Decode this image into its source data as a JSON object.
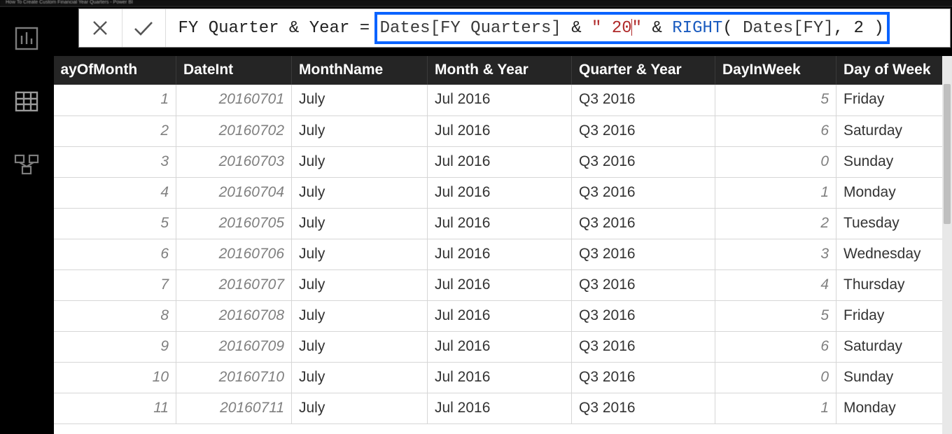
{
  "window_title": "How To Create Custom Financial Year Quarters - Power BI",
  "formula": {
    "measure_name": "FY Quarter & Year",
    "equals": " = ",
    "col1": "Dates[FY Quarters]",
    "amp1": " & ",
    "str_open": "\" 2",
    "str_typing": "0",
    "str_close": "\"",
    "amp2": " & ",
    "fn": "RIGHT",
    "open": "( ",
    "col2": "Dates[FY]",
    "comma": ", ",
    "num": "2",
    "close": " )"
  },
  "columns": [
    {
      "key": "day_of_month",
      "label": "ayOfMonth",
      "num": true
    },
    {
      "key": "date_int",
      "label": "DateInt",
      "num": true
    },
    {
      "key": "month_name",
      "label": "MonthName",
      "num": false
    },
    {
      "key": "month_year",
      "label": "Month & Year",
      "num": false
    },
    {
      "key": "quarter_year",
      "label": "Quarter & Year",
      "num": false
    },
    {
      "key": "day_in_week",
      "label": "DayInWeek",
      "num": true
    },
    {
      "key": "day_of_week",
      "label": "Day of Week",
      "num": false
    }
  ],
  "rows": [
    {
      "day_of_month": "1",
      "date_int": "20160701",
      "month_name": "July",
      "month_year": "Jul 2016",
      "quarter_year": "Q3 2016",
      "day_in_week": "5",
      "day_of_week": "Friday"
    },
    {
      "day_of_month": "2",
      "date_int": "20160702",
      "month_name": "July",
      "month_year": "Jul 2016",
      "quarter_year": "Q3 2016",
      "day_in_week": "6",
      "day_of_week": "Saturday"
    },
    {
      "day_of_month": "3",
      "date_int": "20160703",
      "month_name": "July",
      "month_year": "Jul 2016",
      "quarter_year": "Q3 2016",
      "day_in_week": "0",
      "day_of_week": "Sunday"
    },
    {
      "day_of_month": "4",
      "date_int": "20160704",
      "month_name": "July",
      "month_year": "Jul 2016",
      "quarter_year": "Q3 2016",
      "day_in_week": "1",
      "day_of_week": "Monday"
    },
    {
      "day_of_month": "5",
      "date_int": "20160705",
      "month_name": "July",
      "month_year": "Jul 2016",
      "quarter_year": "Q3 2016",
      "day_in_week": "2",
      "day_of_week": "Tuesday"
    },
    {
      "day_of_month": "6",
      "date_int": "20160706",
      "month_name": "July",
      "month_year": "Jul 2016",
      "quarter_year": "Q3 2016",
      "day_in_week": "3",
      "day_of_week": "Wednesday"
    },
    {
      "day_of_month": "7",
      "date_int": "20160707",
      "month_name": "July",
      "month_year": "Jul 2016",
      "quarter_year": "Q3 2016",
      "day_in_week": "4",
      "day_of_week": "Thursday"
    },
    {
      "day_of_month": "8",
      "date_int": "20160708",
      "month_name": "July",
      "month_year": "Jul 2016",
      "quarter_year": "Q3 2016",
      "day_in_week": "5",
      "day_of_week": "Friday"
    },
    {
      "day_of_month": "9",
      "date_int": "20160709",
      "month_name": "July",
      "month_year": "Jul 2016",
      "quarter_year": "Q3 2016",
      "day_in_week": "6",
      "day_of_week": "Saturday"
    },
    {
      "day_of_month": "10",
      "date_int": "20160710",
      "month_name": "July",
      "month_year": "Jul 2016",
      "quarter_year": "Q3 2016",
      "day_in_week": "0",
      "day_of_week": "Sunday"
    },
    {
      "day_of_month": "11",
      "date_int": "20160711",
      "month_name": "July",
      "month_year": "Jul 2016",
      "quarter_year": "Q3 2016",
      "day_in_week": "1",
      "day_of_week": "Monday"
    }
  ]
}
